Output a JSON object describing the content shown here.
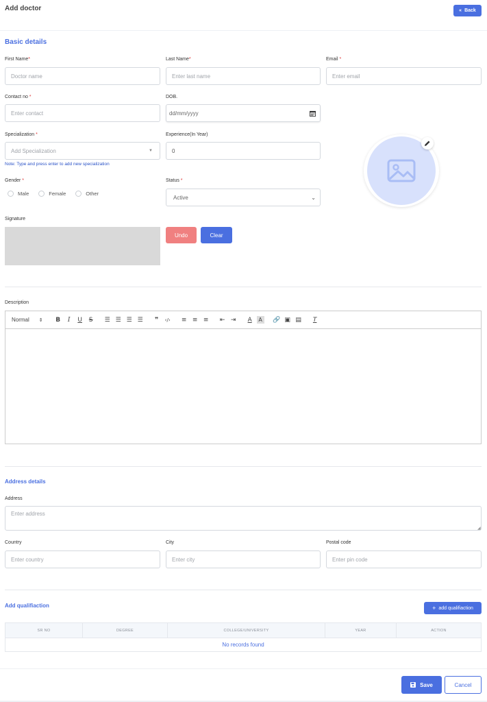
{
  "header": {
    "title": "Add doctor",
    "back_label": "Back"
  },
  "basic": {
    "title": "Basic details",
    "first_name": {
      "label": "First Name",
      "required": "*",
      "placeholder": "Doctor name"
    },
    "last_name": {
      "label": "Last Name",
      "required": "*",
      "placeholder": "Enter last name"
    },
    "email": {
      "label": "Email",
      "required": " *",
      "placeholder": "Enter email"
    },
    "contact": {
      "label": "Contact no",
      "required": " *",
      "placeholder": "Enter contact"
    },
    "dob": {
      "label": "DOB.",
      "placeholder": "dd/mm/yyyy"
    },
    "specialization": {
      "label": "Specialization",
      "required": " *",
      "placeholder": "Add Specialization",
      "note": "Note: Type and press enter to add new specialization"
    },
    "experience": {
      "label": "Experience(In Year)",
      "value": "0"
    },
    "gender": {
      "label": "Gender",
      "required": " *",
      "options": [
        "Male",
        "Female",
        "Other"
      ]
    },
    "status": {
      "label": "Status",
      "required": " *",
      "value": "Active"
    },
    "signature": {
      "label": "Signature",
      "undo": "Undo",
      "clear": "Clear"
    }
  },
  "description": {
    "label": "Description",
    "toolbar": {
      "header_select": "Normal"
    }
  },
  "address": {
    "title": "Address details",
    "address": {
      "label": "Address",
      "placeholder": "Enter address"
    },
    "country": {
      "label": "Country",
      "placeholder": "Enter country"
    },
    "city": {
      "label": "City",
      "placeholder": "Enter city"
    },
    "postal": {
      "label": "Postal code",
      "placeholder": "Enter pin code"
    }
  },
  "qualification": {
    "title": "Add qualifiaction",
    "add_button": "add qualifiaction",
    "columns": [
      "SR NO",
      "DEGREE",
      "COLLEGE/UNIVERSITY",
      "YEAR",
      "ACTION"
    ],
    "empty": "No records found"
  },
  "footer": {
    "save": "Save",
    "cancel": "Cancel"
  },
  "colors": {
    "accent": "#4a6fe0",
    "undo": "#f08080",
    "required": "#dd3333"
  }
}
